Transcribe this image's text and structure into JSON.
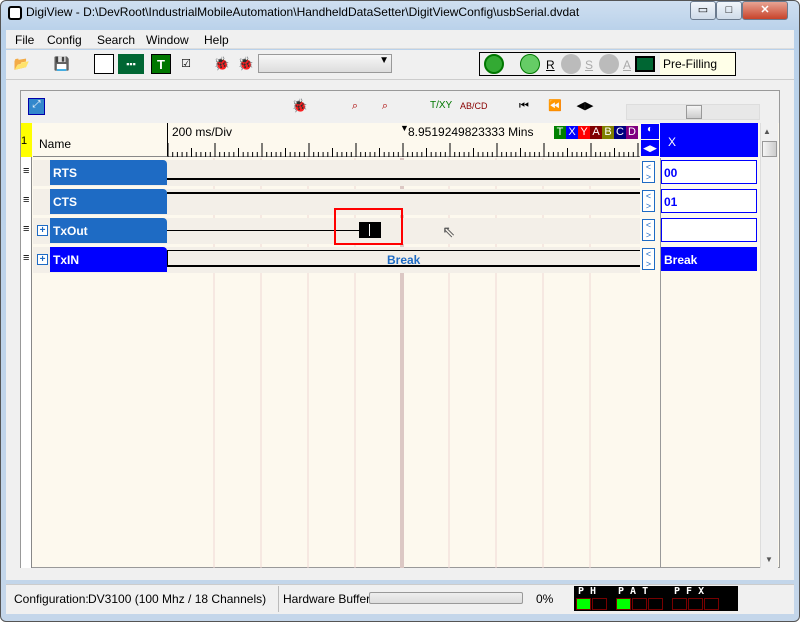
{
  "window": {
    "title": "DigiView - D:\\DevRoot\\IndustrialMobileAutomation\\HandheldDataSetter\\DigitViewConfig\\usbSerial.dvdat",
    "min": "▭",
    "max": "□",
    "close": "✕"
  },
  "menu": [
    "File",
    "Config",
    "Search",
    "Window",
    "Help"
  ],
  "toolbar": {
    "combo_value": "",
    "run_labels": [
      "R",
      "S",
      "A"
    ],
    "status": "Pre-Filling"
  },
  "waveform": {
    "time_per_div": "200 ms/Div",
    "cursor_time": "8.9519249823333 Mins",
    "name_header": "Name",
    "group_number": "1",
    "value_header": "X",
    "cursor_tags": [
      {
        "t": "T",
        "c": "#008000"
      },
      {
        "t": "X",
        "c": "#0000ff"
      },
      {
        "t": "Y",
        "c": "#ff0000"
      },
      {
        "t": "A",
        "c": "#800000"
      },
      {
        "t": "B",
        "c": "#808000"
      },
      {
        "t": "C",
        "c": "#000080"
      },
      {
        "t": "D",
        "c": "#800080"
      }
    ],
    "signals": [
      {
        "name": "RTS",
        "value": "00",
        "expandable": false
      },
      {
        "name": "CTS",
        "value": "01",
        "expandable": false
      },
      {
        "name": "TxOut",
        "value": "",
        "expandable": true
      },
      {
        "name": "TxIN",
        "value": "Break",
        "expandable": true,
        "bus_label": "Break"
      }
    ]
  },
  "statusbar": {
    "config_label": "Configuration:",
    "config_value": "DV3100 (100 Mhz / 18 Channels)",
    "buffer_label": "Hardware Buffer:",
    "buffer_percent": "0%",
    "buffer_fill": 0
  },
  "indicators": {
    "groups": [
      {
        "label": "P H",
        "leds": [
          "on",
          "off"
        ]
      },
      {
        "label": "P A T",
        "leds": [
          "on",
          "off",
          "off"
        ]
      },
      {
        "label": "P F X",
        "leds": [
          "off",
          "off",
          "off"
        ]
      }
    ]
  },
  "colors": {
    "signal": "#1e6bc4",
    "selected": "#0000ff",
    "highlight": "#ff0000",
    "led_on": "#00ff00"
  }
}
